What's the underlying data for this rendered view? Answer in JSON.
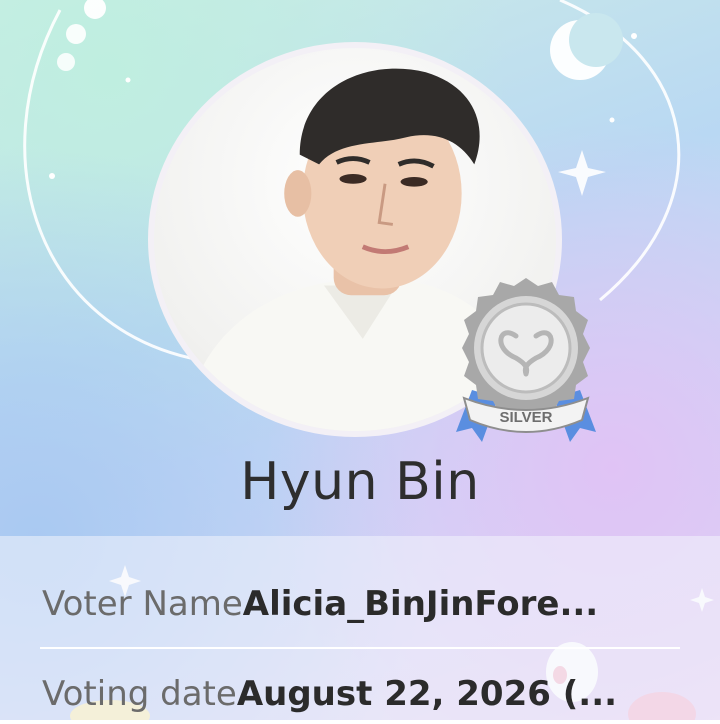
{
  "profile": {
    "name": "Hyun Bin",
    "badge_text": "SILVER"
  },
  "details": {
    "voter_name_label": "Voter Name",
    "voter_name_value": "Alicia_BinJinFore...",
    "voting_date_label": "Voting date",
    "voting_date_value": "August 22, 2026 (..."
  },
  "colors": {
    "name_text": "#2e2e2e",
    "label_text": "#6b6b6b",
    "badge_silver": "#c9c9c9",
    "badge_ribbon": "#5a8ee0"
  }
}
